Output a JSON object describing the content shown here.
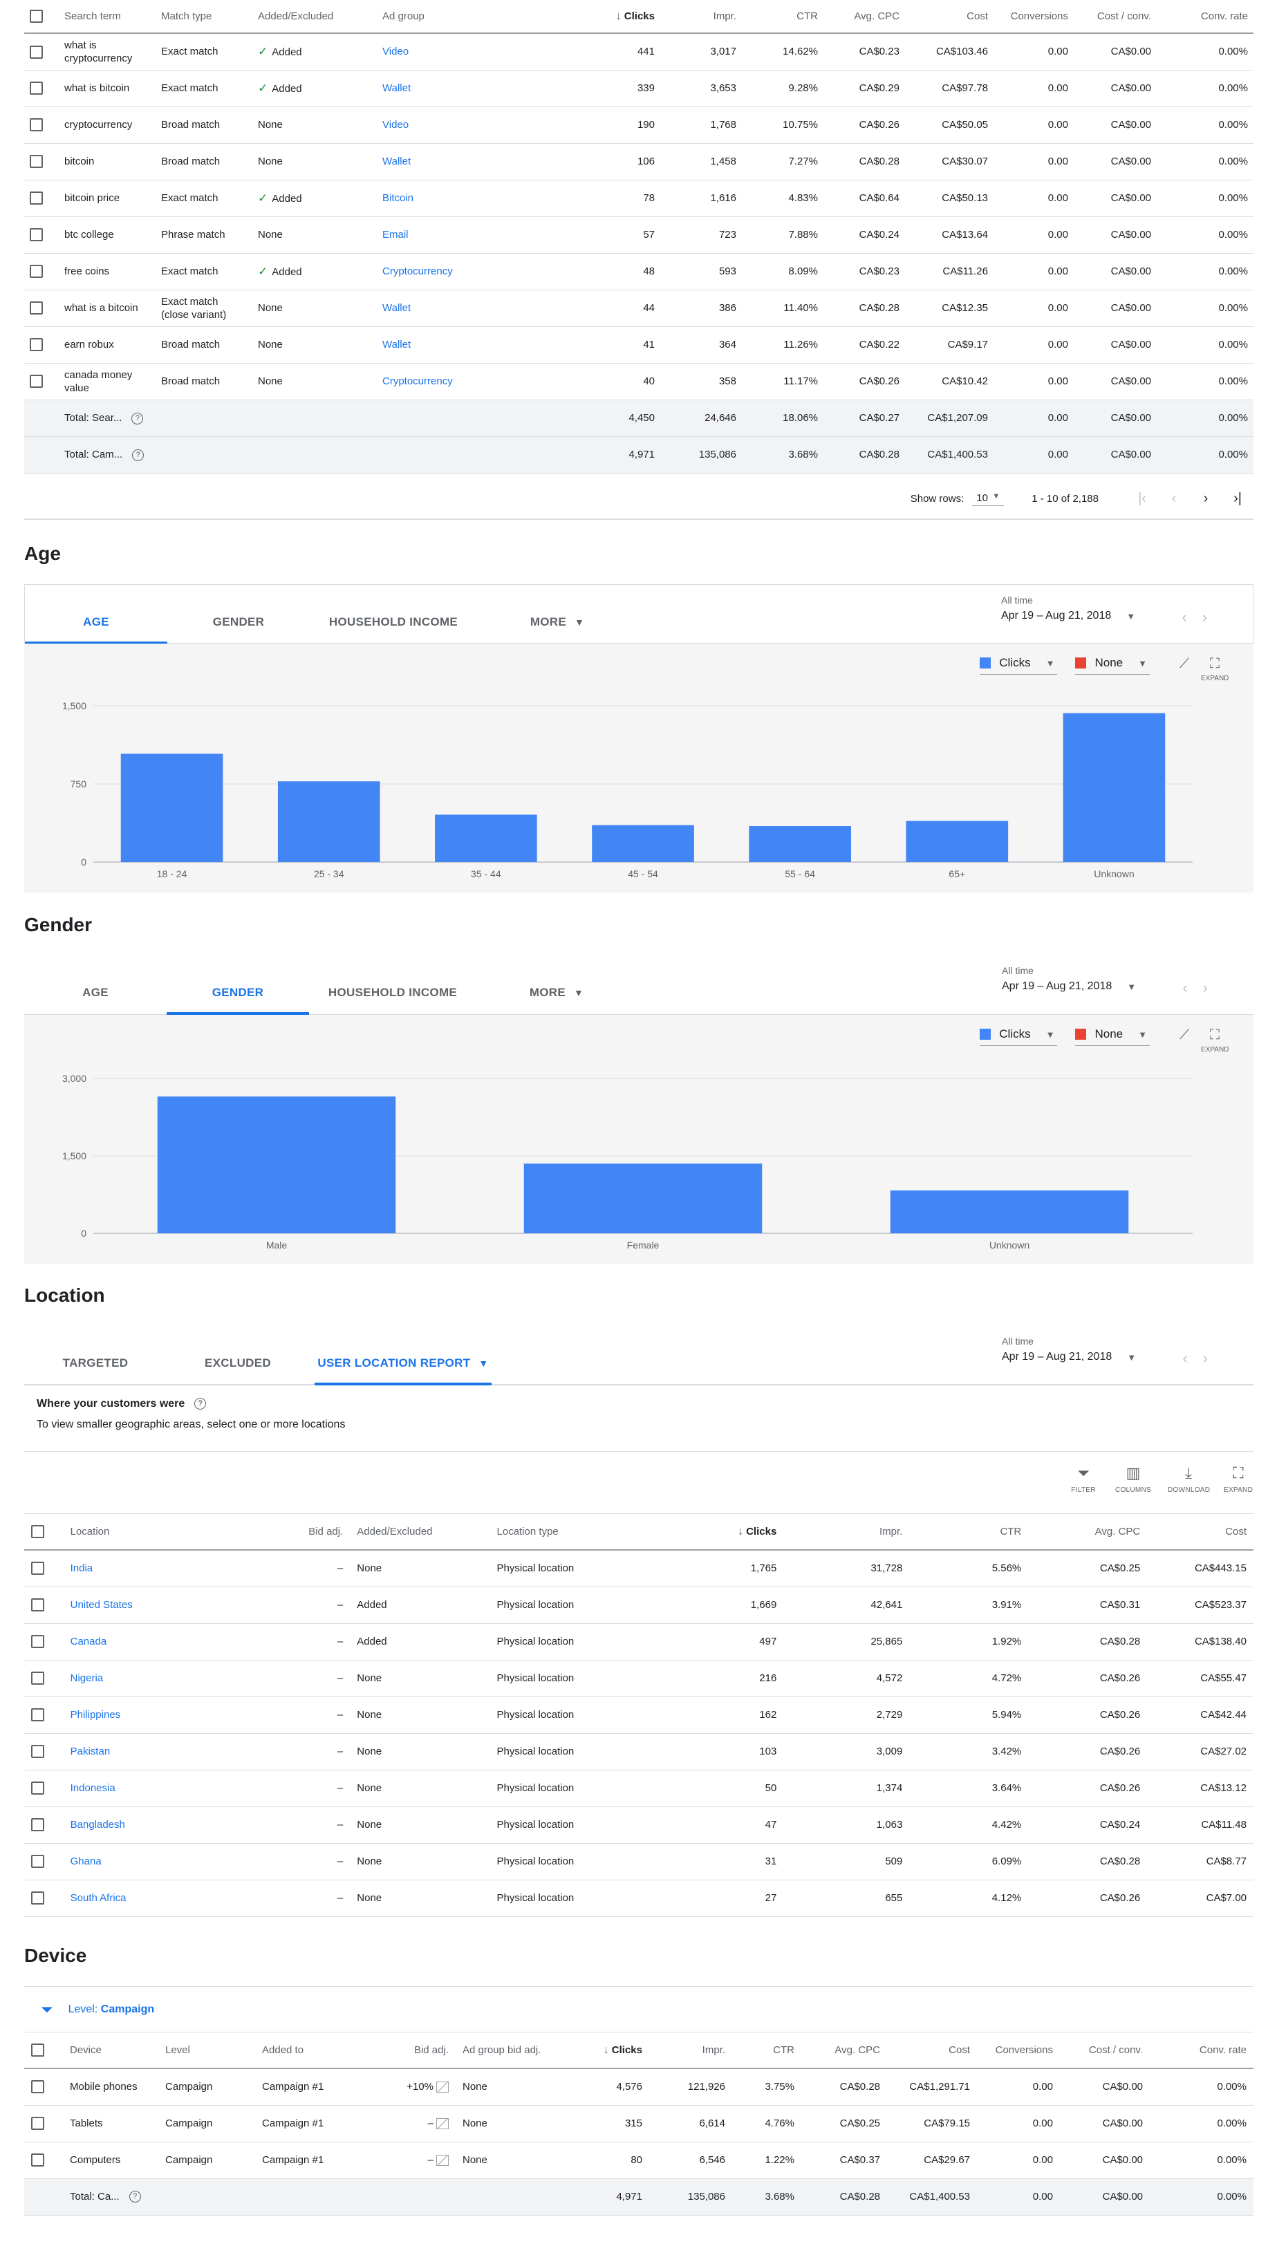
{
  "search_terms": {
    "columns": [
      "Search term",
      "Match type",
      "Added/Excluded",
      "Ad group",
      "Clicks",
      "Impr.",
      "CTR",
      "Avg. CPC",
      "Cost",
      "Conversions",
      "Cost / conv.",
      "Conv. rate"
    ],
    "rows": [
      {
        "term": "what is cryptocurrency",
        "match": "Exact match",
        "added": "Added",
        "added_check": true,
        "group": "Video",
        "clicks": "441",
        "impr": "3,017",
        "ctr": "14.62%",
        "cpc": "CA$0.23",
        "cost": "CA$103.46",
        "conv": "0.00",
        "cpconv": "CA$0.00",
        "rate": "0.00%"
      },
      {
        "term": "what is bitcoin",
        "match": "Exact match",
        "added": "Added",
        "added_check": true,
        "group": "Wallet",
        "clicks": "339",
        "impr": "3,653",
        "ctr": "9.28%",
        "cpc": "CA$0.29",
        "cost": "CA$97.78",
        "conv": "0.00",
        "cpconv": "CA$0.00",
        "rate": "0.00%"
      },
      {
        "term": "cryptocurrency",
        "match": "Broad match",
        "added": "None",
        "added_check": false,
        "group": "Video",
        "clicks": "190",
        "impr": "1,768",
        "ctr": "10.75%",
        "cpc": "CA$0.26",
        "cost": "CA$50.05",
        "conv": "0.00",
        "cpconv": "CA$0.00",
        "rate": "0.00%"
      },
      {
        "term": "bitcoin",
        "match": "Broad match",
        "added": "None",
        "added_check": false,
        "group": "Wallet",
        "clicks": "106",
        "impr": "1,458",
        "ctr": "7.27%",
        "cpc": "CA$0.28",
        "cost": "CA$30.07",
        "conv": "0.00",
        "cpconv": "CA$0.00",
        "rate": "0.00%"
      },
      {
        "term": "bitcoin price",
        "match": "Exact match",
        "added": "Added",
        "added_check": true,
        "group": "Bitcoin",
        "clicks": "78",
        "impr": "1,616",
        "ctr": "4.83%",
        "cpc": "CA$0.64",
        "cost": "CA$50.13",
        "conv": "0.00",
        "cpconv": "CA$0.00",
        "rate": "0.00%"
      },
      {
        "term": "btc college",
        "match": "Phrase match",
        "added": "None",
        "added_check": false,
        "group": "Email",
        "clicks": "57",
        "impr": "723",
        "ctr": "7.88%",
        "cpc": "CA$0.24",
        "cost": "CA$13.64",
        "conv": "0.00",
        "cpconv": "CA$0.00",
        "rate": "0.00%"
      },
      {
        "term": "free coins",
        "match": "Exact match",
        "added": "Added",
        "added_check": true,
        "group": "Cryptocurrency",
        "clicks": "48",
        "impr": "593",
        "ctr": "8.09%",
        "cpc": "CA$0.23",
        "cost": "CA$11.26",
        "conv": "0.00",
        "cpconv": "CA$0.00",
        "rate": "0.00%"
      },
      {
        "term": "what is a bitcoin",
        "match": "Exact match (close variant)",
        "added": "None",
        "added_check": false,
        "group": "Wallet",
        "clicks": "44",
        "impr": "386",
        "ctr": "11.40%",
        "cpc": "CA$0.28",
        "cost": "CA$12.35",
        "conv": "0.00",
        "cpconv": "CA$0.00",
        "rate": "0.00%"
      },
      {
        "term": "earn robux",
        "match": "Broad match",
        "added": "None",
        "added_check": false,
        "group": "Wallet",
        "clicks": "41",
        "impr": "364",
        "ctr": "11.26%",
        "cpc": "CA$0.22",
        "cost": "CA$9.17",
        "conv": "0.00",
        "cpconv": "CA$0.00",
        "rate": "0.00%"
      },
      {
        "term": "canada money value",
        "match": "Broad match",
        "added": "None",
        "added_check": false,
        "group": "Cryptocurrency",
        "clicks": "40",
        "impr": "358",
        "ctr": "11.17%",
        "cpc": "CA$0.26",
        "cost": "CA$10.42",
        "conv": "0.00",
        "cpconv": "CA$0.00",
        "rate": "0.00%"
      }
    ],
    "totals": [
      {
        "label": "Total: Sear...",
        "clicks": "4,450",
        "impr": "24,646",
        "ctr": "18.06%",
        "cpc": "CA$0.27",
        "cost": "CA$1,207.09",
        "conv": "0.00",
        "cpconv": "CA$0.00",
        "rate": "0.00%"
      },
      {
        "label": "Total: Cam...",
        "clicks": "4,971",
        "impr": "135,086",
        "ctr": "3.68%",
        "cpc": "CA$0.28",
        "cost": "CA$1,400.53",
        "conv": "0.00",
        "cpconv": "CA$0.00",
        "rate": "0.00%"
      }
    ],
    "pager": {
      "show_rows_label": "Show rows:",
      "show_rows_value": "10",
      "range": "1 - 10 of 2,188"
    }
  },
  "date": {
    "label": "All time",
    "value": "Apr 19 – Aug 21, 2018"
  },
  "age": {
    "title": "Age",
    "tabs": [
      "AGE",
      "GENDER",
      "HOUSEHOLD INCOME",
      "MORE"
    ],
    "legend": {
      "metric1": "Clicks",
      "metric2": "None",
      "expand": "EXPAND"
    }
  },
  "gender": {
    "title": "Gender",
    "tabs": [
      "AGE",
      "GENDER",
      "HOUSEHOLD INCOME",
      "MORE"
    ],
    "legend": {
      "metric1": "Clicks",
      "metric2": "None",
      "expand": "EXPAND"
    }
  },
  "chart_data": [
    {
      "type": "bar",
      "categories": [
        "18 - 24",
        "25 - 34",
        "35 - 44",
        "45 - 54",
        "55 - 64",
        "65+",
        "Unknown"
      ],
      "values": [
        1040,
        775,
        455,
        355,
        345,
        395,
        1430
      ],
      "yticks": [
        "0",
        "750",
        "1,500"
      ],
      "ylim": [
        0,
        1500
      ],
      "grid": true,
      "color": "#4285f4"
    },
    {
      "type": "bar",
      "categories": [
        "Male",
        "Female",
        "Unknown"
      ],
      "values": [
        2650,
        1350,
        830
      ],
      "yticks": [
        "0",
        "1,500",
        "3,000"
      ],
      "ylim": [
        0,
        3000
      ],
      "grid": true,
      "color": "#4285f4"
    }
  ],
  "location": {
    "title": "Location",
    "tabs": [
      "TARGETED",
      "EXCLUDED",
      "USER LOCATION REPORT"
    ],
    "heading": "Where your customers were",
    "subheading": "To view smaller geographic areas, select one or more locations",
    "tools": [
      "FILTER",
      "COLUMNS",
      "DOWNLOAD",
      "EXPAND"
    ],
    "columns": [
      "Location",
      "Bid adj.",
      "Added/Excluded",
      "Location type",
      "Clicks",
      "Impr.",
      "CTR",
      "Avg. CPC",
      "Cost"
    ],
    "rows": [
      {
        "loc": "India",
        "bid": "–",
        "added": "None",
        "type": "Physical location",
        "clicks": "1,765",
        "impr": "31,728",
        "ctr": "5.56%",
        "cpc": "CA$0.25",
        "cost": "CA$443.15"
      },
      {
        "loc": "United States",
        "bid": "–",
        "added": "Added",
        "type": "Physical location",
        "clicks": "1,669",
        "impr": "42,641",
        "ctr": "3.91%",
        "cpc": "CA$0.31",
        "cost": "CA$523.37"
      },
      {
        "loc": "Canada",
        "bid": "–",
        "added": "Added",
        "type": "Physical location",
        "clicks": "497",
        "impr": "25,865",
        "ctr": "1.92%",
        "cpc": "CA$0.28",
        "cost": "CA$138.40"
      },
      {
        "loc": "Nigeria",
        "bid": "–",
        "added": "None",
        "type": "Physical location",
        "clicks": "216",
        "impr": "4,572",
        "ctr": "4.72%",
        "cpc": "CA$0.26",
        "cost": "CA$55.47"
      },
      {
        "loc": "Philippines",
        "bid": "–",
        "added": "None",
        "type": "Physical location",
        "clicks": "162",
        "impr": "2,729",
        "ctr": "5.94%",
        "cpc": "CA$0.26",
        "cost": "CA$42.44"
      },
      {
        "loc": "Pakistan",
        "bid": "–",
        "added": "None",
        "type": "Physical location",
        "clicks": "103",
        "impr": "3,009",
        "ctr": "3.42%",
        "cpc": "CA$0.26",
        "cost": "CA$27.02"
      },
      {
        "loc": "Indonesia",
        "bid": "–",
        "added": "None",
        "type": "Physical location",
        "clicks": "50",
        "impr": "1,374",
        "ctr": "3.64%",
        "cpc": "CA$0.26",
        "cost": "CA$13.12"
      },
      {
        "loc": "Bangladesh",
        "bid": "–",
        "added": "None",
        "type": "Physical location",
        "clicks": "47",
        "impr": "1,063",
        "ctr": "4.42%",
        "cpc": "CA$0.24",
        "cost": "CA$11.48"
      },
      {
        "loc": "Ghana",
        "bid": "–",
        "added": "None",
        "type": "Physical location",
        "clicks": "31",
        "impr": "509",
        "ctr": "6.09%",
        "cpc": "CA$0.28",
        "cost": "CA$8.77"
      },
      {
        "loc": "South Africa",
        "bid": "–",
        "added": "None",
        "type": "Physical location",
        "clicks": "27",
        "impr": "655",
        "ctr": "4.12%",
        "cpc": "CA$0.26",
        "cost": "CA$7.00"
      }
    ]
  },
  "device": {
    "title": "Device",
    "level_label": "Level:",
    "level_value": "Campaign",
    "columns": [
      "Device",
      "Level",
      "Added to",
      "Bid adj.",
      "Ad group bid adj.",
      "Clicks",
      "Impr.",
      "CTR",
      "Avg. CPC",
      "Cost",
      "Conversions",
      "Cost / conv.",
      "Conv. rate"
    ],
    "rows": [
      {
        "device": "Mobile phones",
        "level": "Campaign",
        "added": "Campaign #1",
        "bid": "+10%",
        "agbid": "None",
        "clicks": "4,576",
        "impr": "121,926",
        "ctr": "3.75%",
        "cpc": "CA$0.28",
        "cost": "CA$1,291.71",
        "conv": "0.00",
        "cpconv": "CA$0.00",
        "rate": "0.00%"
      },
      {
        "device": "Tablets",
        "level": "Campaign",
        "added": "Campaign #1",
        "bid": "–",
        "agbid": "None",
        "clicks": "315",
        "impr": "6,614",
        "ctr": "4.76%",
        "cpc": "CA$0.25",
        "cost": "CA$79.15",
        "conv": "0.00",
        "cpconv": "CA$0.00",
        "rate": "0.00%"
      },
      {
        "device": "Computers",
        "level": "Campaign",
        "added": "Campaign #1",
        "bid": "–",
        "agbid": "None",
        "clicks": "80",
        "impr": "6,546",
        "ctr": "1.22%",
        "cpc": "CA$0.37",
        "cost": "CA$29.67",
        "conv": "0.00",
        "cpconv": "CA$0.00",
        "rate": "0.00%"
      }
    ],
    "total": {
      "label": "Total: Ca...",
      "clicks": "4,971",
      "impr": "135,086",
      "ctr": "3.68%",
      "cpc": "CA$0.28",
      "cost": "CA$1,400.53",
      "conv": "0.00",
      "cpconv": "CA$0.00",
      "rate": "0.00%"
    }
  }
}
